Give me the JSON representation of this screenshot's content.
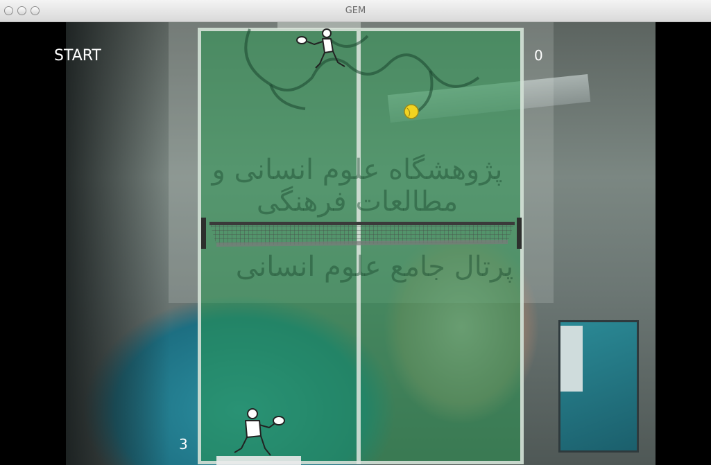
{
  "window": {
    "title": "GEM"
  },
  "game": {
    "start_label": "START",
    "score_top": "0",
    "score_bottom": "3"
  },
  "watermark": {
    "line1": "پژوهشگاه علوم انسانی و مطالعات فرهنگی",
    "line2": "پرتال جامع علوم انسانی"
  },
  "icons": {
    "top_player": "tennis-player-icon",
    "bottom_player": "tennis-player-icon",
    "ball": "tennis-ball-icon",
    "net": "tennis-net"
  },
  "colors": {
    "court": "#289650",
    "court_lines": "#e1e6e1",
    "ball": "#f2d321",
    "text": "#ffffff"
  }
}
